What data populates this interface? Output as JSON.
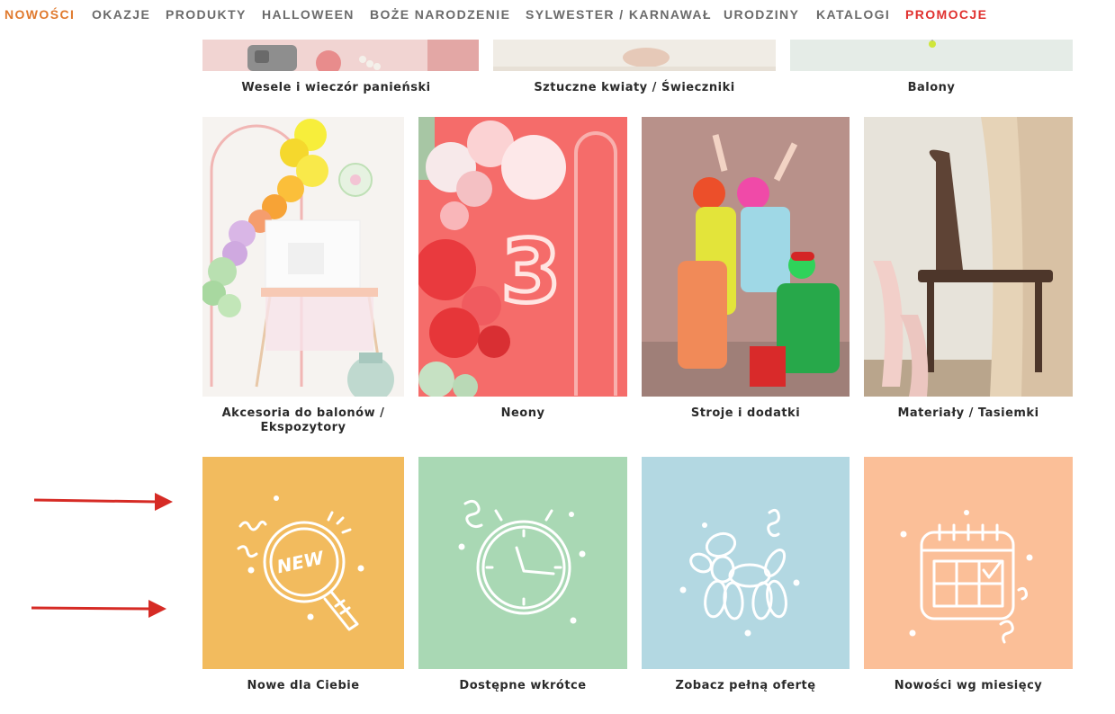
{
  "nav": {
    "items": [
      {
        "label": "NOWOŚCI",
        "color": "#e07a2e"
      },
      {
        "label": "OKAZJE",
        "color": "#6b6b6b"
      },
      {
        "label": "PRODUKTY",
        "color": "#6b6b6b"
      },
      {
        "label": "HALLOWEEN",
        "color": "#6b6b6b"
      },
      {
        "label": "BOŻE NARODZENIE",
        "color": "#6b6b6b"
      },
      {
        "label": "SYLWESTER / KARNAWAŁ",
        "color": "#6b6b6b"
      },
      {
        "label": "URODZINY",
        "color": "#6b6b6b"
      },
      {
        "label": "KATALOGI",
        "color": "#6b6b6b"
      },
      {
        "label": "PROMOCJE",
        "color": "#e0312f"
      }
    ]
  },
  "row1": {
    "captions": [
      "Wesele i wieczór panieński",
      "Sztuczne kwiaty / Świeczniki",
      "Balony"
    ]
  },
  "row2": {
    "tiles": [
      {
        "caption_line1": "Akcesoria do balonów /",
        "caption_line2": "Ekspozytory"
      },
      {
        "caption_line1": "Neony",
        "caption_line2": ""
      },
      {
        "caption_line1": "Stroje i dodatki",
        "caption_line2": ""
      },
      {
        "caption_line1": "Materiały / Tasiemki",
        "caption_line2": ""
      }
    ]
  },
  "row3": {
    "tiles": [
      {
        "caption": "Nowe dla Ciebie",
        "bg": "#f2bb5e",
        "icon": "magnifier-new-icon",
        "badge": "NEW"
      },
      {
        "caption": "Dostępne wkrótce",
        "bg": "#a9d8b4",
        "icon": "clock-icon"
      },
      {
        "caption": "Zobacz pełną ofertę",
        "bg": "#b3d8e2",
        "icon": "balloon-dog-icon"
      },
      {
        "caption": "Nowości wg miesięcy",
        "bg": "#fbbf98",
        "icon": "calendar-icon"
      }
    ]
  },
  "annotations": {
    "arrow_color": "#d62b25"
  }
}
